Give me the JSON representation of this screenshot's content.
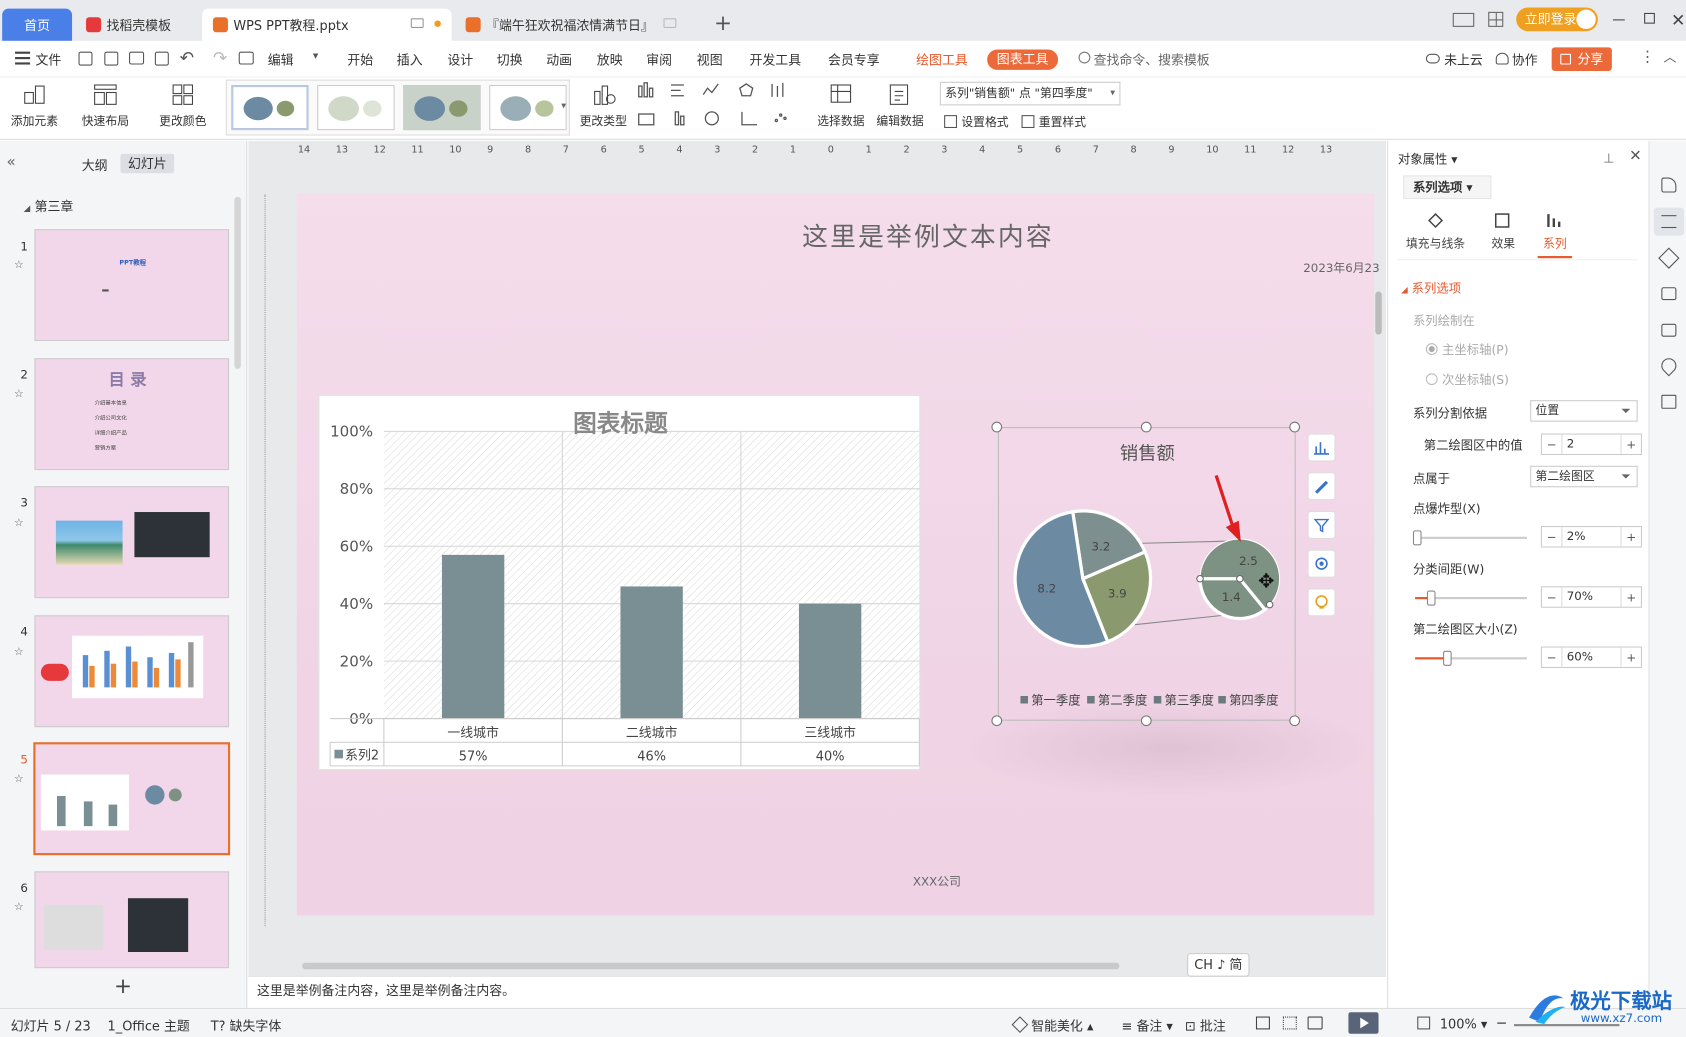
{
  "tabs": {
    "home": "首页",
    "find_template": "找稻壳模板",
    "doc1": "WPS PPT教程.pptx",
    "doc2": "『端午狂欢祝福浓情满节日』",
    "add": "+"
  },
  "titlebar": {
    "login": "立即登录"
  },
  "menu": {
    "file": "文件",
    "edit": "编辑",
    "items": [
      "开始",
      "插入",
      "设计",
      "切换",
      "动画",
      "放映",
      "审阅",
      "视图",
      "开发工具",
      "会员专享"
    ],
    "draw_tools": "绘图工具",
    "chart_tools": "图表工具",
    "search_placeholder": "查找命令、搜索模板",
    "cloud": "未上云",
    "collab": "协作",
    "share": "分享"
  },
  "ribbon": {
    "add_element": "添加元素",
    "quick_layout": "快速布局",
    "change_color": "更改颜色",
    "change_type": "更改类型",
    "select_data": "选择数据",
    "edit_data": "编辑数据",
    "series_select": "系列\"销售额\" 点 \"第四季度\"",
    "set_format": "设置格式",
    "reset_style": "重置样式"
  },
  "leftpane": {
    "outline": "大纲",
    "slides": "幻灯片",
    "section": "第三章",
    "slide_numbers": [
      "1",
      "2",
      "3",
      "4",
      "5",
      "6"
    ],
    "slide1_title": "PPT教程",
    "slide2_title": "目 录",
    "slide2_items": [
      "介绍基本信息",
      "介绍公司文化",
      "详细介绍产品",
      "营销方案"
    ]
  },
  "ruler": {
    "labels": [
      "14",
      "13",
      "12",
      "11",
      "10",
      "9",
      "8",
      "7",
      "6",
      "5",
      "4",
      "3",
      "2",
      "1",
      "0",
      "1",
      "2",
      "3",
      "4",
      "5",
      "6",
      "7",
      "8",
      "9",
      "10",
      "11",
      "12",
      "13"
    ]
  },
  "slide": {
    "title": "这里是举例文本内容",
    "date": "2023年6月23",
    "footer": "XXX公司"
  },
  "chart_data": [
    {
      "type": "bar",
      "title": "图表标题",
      "categories": [
        "一线城市",
        "二线城市",
        "三线城市"
      ],
      "series": [
        {
          "name": "系列2",
          "values": [
            0.57,
            0.46,
            0.4
          ]
        }
      ],
      "value_labels": [
        "57%",
        "46%",
        "40%"
      ],
      "ylim": [
        0,
        1
      ],
      "yticks": [
        "100%",
        "80%",
        "60%",
        "40%",
        "20%",
        "0%"
      ],
      "color": "#7a8f93",
      "data_table": true
    },
    {
      "type": "pie",
      "subtype": "pie-of-pie",
      "title": "销售额",
      "categories": [
        "第一季度",
        "第二季度",
        "第三季度",
        "第四季度"
      ],
      "values": [
        8.2,
        3.2,
        3.9,
        1.4
      ],
      "secondary_values": [
        2.5,
        1.4
      ],
      "labels": [
        "8.2",
        "3.2",
        "3.9",
        "2.5",
        "1.4"
      ],
      "colors": [
        "#6d8aa3",
        "#7d8f8f",
        "#8a9a6e",
        "#7d9282"
      ]
    }
  ],
  "notes": "这里是举例备注内容，这里是举例备注内容。",
  "ime": "CH ♪ 简",
  "rightpane": {
    "title": "对象属性",
    "tab": "系列选项",
    "sub_tabs": [
      "填充与线条",
      "效果",
      "系列"
    ],
    "section": "系列选项",
    "plot_on": "系列绘制在",
    "primary_axis": "主坐标轴(P)",
    "secondary_axis": "次坐标轴(S)",
    "split_by": "系列分割依据",
    "split_value": "位置",
    "second_plot_values": "第二绘图区中的值",
    "second_plot_count": "2",
    "point_in": "点属于",
    "point_in_value": "第二绘图区",
    "explosion": "点爆炸型(X)",
    "explosion_value": "2%",
    "explosion_level": 0.02,
    "gap": "分类间距(W)",
    "gap_value": "70%",
    "gap_level": 0.14,
    "size": "第二绘图区大小(Z)",
    "size_value": "60%",
    "size_level": 0.29
  },
  "status": {
    "slide": "幻灯片 5 / 23",
    "theme": "1_Office 主题",
    "missing_font": "缺失字体",
    "beautify": "智能美化",
    "notes": "备注",
    "comment": "批注",
    "zoom": "100%"
  },
  "watermark": {
    "name": "极光下载站",
    "url": "www.xz7.com"
  }
}
